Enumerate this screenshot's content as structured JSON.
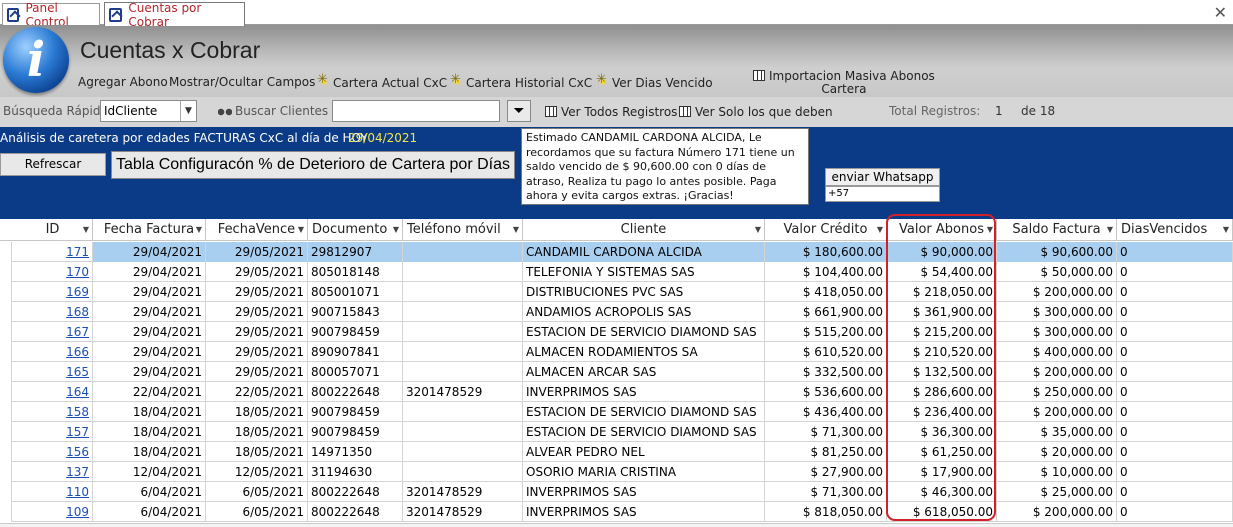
{
  "tabs": [
    {
      "label": "Panel Control"
    },
    {
      "label": "Cuentas por Cobrar"
    }
  ],
  "header": {
    "title": "Cuentas x Cobrar",
    "buttons": {
      "agregar": "Agregar Abono",
      "mostrar": "Mostrar/Ocultar Campos",
      "cartera_actual": "Cartera Actual CxC",
      "cartera_historial": "Cartera Historial CxC",
      "dias_vencido": "Ver Dias Vencido",
      "importacion_line1": "Importacion Masiva Abonos",
      "importacion_line2": "Cartera"
    }
  },
  "searchbar": {
    "busqueda_label": "Búsqueda Rápida",
    "combo_value": "IdCliente",
    "buscar_clientes": "Buscar Clientes",
    "search_value": "",
    "ver_todos": "Ver Todos Registros",
    "ver_solo": "Ver Solo los que deben",
    "total_label": "Total Registros:",
    "current": "1",
    "of_total": "de 18"
  },
  "panel": {
    "analysis_label": "Análisis de caretera por edades FACTURAS CxC  al día de HOY",
    "date": "29/04/2021",
    "refresh": "Refrescar",
    "config": "Tabla Configuracón % de Deterioro de Cartera por Días",
    "message": "Estimado CANDAMIL CARDONA ALCIDA, Le recordamos que su factura Número 171 tiene un saldo vencido de $ 90,600.00 con 0 días de atraso, Realiza tu pago lo antes posible. Paga ahora y evita cargos extras. ¡Gracias!",
    "whatsapp_button": "enviar Whatsapp",
    "whatsapp_number": "+57"
  },
  "table": {
    "columns": [
      "ID",
      "Fecha Factura",
      "FechaVence",
      "Documento",
      "Teléfono móvil",
      "Cliente",
      "Valor Crédito",
      "Valor Abonos",
      "Saldo Factura",
      "DiasVencidos"
    ],
    "rows": [
      [
        "171",
        "29/04/2021",
        "29/05/2021",
        "29812907",
        "",
        "CANDAMIL CARDONA ALCIDA",
        "$ 180,600.00",
        "$ 90,000.00",
        "$ 90,600.00",
        "0"
      ],
      [
        "170",
        "29/04/2021",
        "29/05/2021",
        "805018148",
        "",
        "TELEFONIA Y SISTEMAS SAS",
        "$ 104,400.00",
        "$ 54,400.00",
        "$ 50,000.00",
        "0"
      ],
      [
        "169",
        "29/04/2021",
        "29/05/2021",
        "805001071",
        "",
        "DISTRIBUCIONES PVC SAS",
        "$ 418,050.00",
        "$ 218,050.00",
        "$ 200,000.00",
        "0"
      ],
      [
        "168",
        "29/04/2021",
        "29/05/2021",
        "900715843",
        "",
        "ANDAMIOS ACROPOLIS SAS",
        "$ 661,900.00",
        "$ 361,900.00",
        "$ 300,000.00",
        "0"
      ],
      [
        "167",
        "29/04/2021",
        "29/05/2021",
        "900798459",
        "",
        "ESTACION DE SERVICIO DIAMOND SAS",
        "$ 515,200.00",
        "$ 215,200.00",
        "$ 300,000.00",
        "0"
      ],
      [
        "166",
        "29/04/2021",
        "29/05/2021",
        "890907841",
        "",
        "ALMACEN RODAMIENTOS SA",
        "$ 610,520.00",
        "$ 210,520.00",
        "$ 400,000.00",
        "0"
      ],
      [
        "165",
        "29/04/2021",
        "29/05/2021",
        "800057071",
        "",
        "ALMACEN ARCAR SAS",
        "$ 332,500.00",
        "$ 132,500.00",
        "$ 200,000.00",
        "0"
      ],
      [
        "164",
        "22/04/2021",
        "22/05/2021",
        "800222648",
        "3201478529",
        "INVERPRIMOS SAS",
        "$ 536,600.00",
        "$ 286,600.00",
        "$ 250,000.00",
        "0"
      ],
      [
        "158",
        "18/04/2021",
        "18/05/2021",
        "900798459",
        "",
        "ESTACION DE SERVICIO DIAMOND SAS",
        "$ 436,400.00",
        "$ 236,400.00",
        "$ 200,000.00",
        "0"
      ],
      [
        "157",
        "18/04/2021",
        "18/05/2021",
        "900798459",
        "",
        "ESTACION DE SERVICIO DIAMOND SAS",
        "$ 71,300.00",
        "$ 36,300.00",
        "$ 35,000.00",
        "0"
      ],
      [
        "156",
        "18/04/2021",
        "18/05/2021",
        "14971350",
        "",
        "ALVEAR PEDRO NEL",
        "$ 81,250.00",
        "$ 61,250.00",
        "$ 20,000.00",
        "0"
      ],
      [
        "137",
        "12/04/2021",
        "12/05/2021",
        "31194630",
        "",
        "OSORIO MARIA CRISTINA",
        "$ 27,900.00",
        "$ 17,900.00",
        "$ 10,000.00",
        "0"
      ],
      [
        "110",
        "6/04/2021",
        "6/05/2021",
        "800222648",
        "3201478529",
        "INVERPRIMOS SAS",
        "$ 71,300.00",
        "$ 46,300.00",
        "$ 25,000.00",
        "0"
      ],
      [
        "109",
        "6/04/2021",
        "6/05/2021",
        "800222648",
        "3201478529",
        "INVERPRIMOS SAS",
        "$ 818,050.00",
        "$ 618,050.00",
        "$ 200,000.00",
        "0"
      ]
    ]
  },
  "colors": {
    "panel_blue": "#0b3a86",
    "selected_row": "#a9cff0",
    "link": "#1d4fb4",
    "highlight_box": "#d1202a",
    "date_yellow": "#f3e64a"
  }
}
